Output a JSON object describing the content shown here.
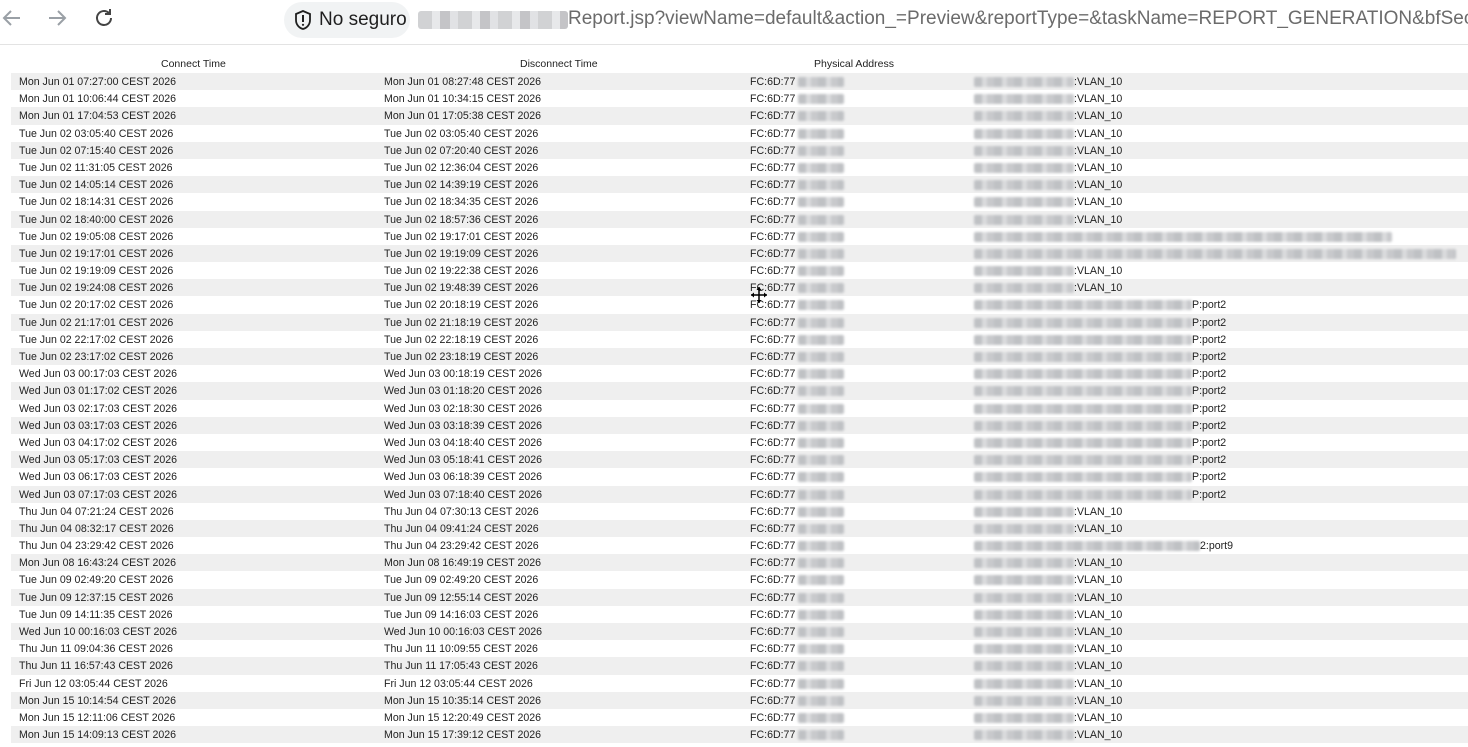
{
  "browser": {
    "security_label": "No seguro",
    "url_path": "Report.jsp?viewName=default&action_=Preview&reportType=&taskName=REPORT_GENERATION&bfSecKey=nx"
  },
  "columns": [
    "Connect Time",
    "Disconnect Time",
    "Physical Address"
  ],
  "rows": [
    {
      "connect": "Mon Jun 01 07:27:00 CEST 2026",
      "disconnect": "Mon Jun 01 08:27:48 CEST 2026",
      "mac": "FC:6D:77",
      "suffix": ":VLAN_10"
    },
    {
      "connect": "Mon Jun 01 10:06:44 CEST 2026",
      "disconnect": "Mon Jun 01 10:34:15 CEST 2026",
      "mac": "FC:6D:77",
      "suffix": ":VLAN_10"
    },
    {
      "connect": "Mon Jun 01 17:04:53 CEST 2026",
      "disconnect": "Mon Jun 01 17:05:38 CEST 2026",
      "mac": "FC:6D:77",
      "suffix": ":VLAN_10"
    },
    {
      "connect": "Tue Jun 02 03:05:40 CEST 2026",
      "disconnect": "Tue Jun 02 03:05:40 CEST 2026",
      "mac": "FC:6D:77",
      "suffix": ":VLAN_10"
    },
    {
      "connect": "Tue Jun 02 07:15:40 CEST 2026",
      "disconnect": "Tue Jun 02 07:20:40 CEST 2026",
      "mac": "FC:6D:77",
      "suffix": ":VLAN_10"
    },
    {
      "connect": "Tue Jun 02 11:31:05 CEST 2026",
      "disconnect": "Tue Jun 02 12:36:04 CEST 2026",
      "mac": "FC:6D:77",
      "suffix": ":VLAN_10"
    },
    {
      "connect": "Tue Jun 02 14:05:14 CEST 2026",
      "disconnect": "Tue Jun 02 14:39:19 CEST 2026",
      "mac": "FC:6D:77",
      "suffix": ":VLAN_10"
    },
    {
      "connect": "Tue Jun 02 18:14:31 CEST 2026",
      "disconnect": "Tue Jun 02 18:34:35 CEST 2026",
      "mac": "FC:6D:77",
      "suffix": ":VLAN_10"
    },
    {
      "connect": "Tue Jun 02 18:40:00 CEST 2026",
      "disconnect": "Tue Jun 02 18:57:36 CEST 2026",
      "mac": "FC:6D:77",
      "suffix": ":VLAN_10"
    },
    {
      "connect": "Tue Jun 02 19:05:08 CEST 2026",
      "disconnect": "Tue Jun 02 19:17:01 CEST 2026",
      "mac": "FC:6D:77",
      "suffix": ""
    },
    {
      "connect": "Tue Jun 02 19:17:01 CEST 2026",
      "disconnect": "Tue Jun 02 19:19:09 CEST 2026",
      "mac": "FC:6D:77",
      "suffix": ""
    },
    {
      "connect": "Tue Jun 02 19:19:09 CEST 2026",
      "disconnect": "Tue Jun 02 19:22:38 CEST 2026",
      "mac": "FC:6D:77",
      "suffix": ":VLAN_10"
    },
    {
      "connect": "Tue Jun 02 19:24:08 CEST 2026",
      "disconnect": "Tue Jun 02 19:48:39 CEST 2026",
      "mac": "FC:6D:77",
      "suffix": ":VLAN_10"
    },
    {
      "connect": "Tue Jun 02 20:17:02 CEST 2026",
      "disconnect": "Tue Jun 02 20:18:19 CEST 2026",
      "mac": "FC:6D:77",
      "suffix": "P:port2"
    },
    {
      "connect": "Tue Jun 02 21:17:01 CEST 2026",
      "disconnect": "Tue Jun 02 21:18:19 CEST 2026",
      "mac": "FC:6D:77",
      "suffix": "P:port2"
    },
    {
      "connect": "Tue Jun 02 22:17:02 CEST 2026",
      "disconnect": "Tue Jun 02 22:18:19 CEST 2026",
      "mac": "FC:6D:77",
      "suffix": "P:port2"
    },
    {
      "connect": "Tue Jun 02 23:17:02 CEST 2026",
      "disconnect": "Tue Jun 02 23:18:19 CEST 2026",
      "mac": "FC:6D:77",
      "suffix": "P:port2"
    },
    {
      "connect": "Wed Jun 03 00:17:03 CEST 2026",
      "disconnect": "Wed Jun 03 00:18:19 CEST 2026",
      "mac": "FC:6D:77",
      "suffix": "P:port2"
    },
    {
      "connect": "Wed Jun 03 01:17:02 CEST 2026",
      "disconnect": "Wed Jun 03 01:18:20 CEST 2026",
      "mac": "FC:6D:77",
      "suffix": "P:port2"
    },
    {
      "connect": "Wed Jun 03 02:17:03 CEST 2026",
      "disconnect": "Wed Jun 03 02:18:30 CEST 2026",
      "mac": "FC:6D:77",
      "suffix": "P:port2"
    },
    {
      "connect": "Wed Jun 03 03:17:03 CEST 2026",
      "disconnect": "Wed Jun 03 03:18:39 CEST 2026",
      "mac": "FC:6D:77",
      "suffix": "P:port2"
    },
    {
      "connect": "Wed Jun 03 04:17:02 CEST 2026",
      "disconnect": "Wed Jun 03 04:18:40 CEST 2026",
      "mac": "FC:6D:77",
      "suffix": "P:port2"
    },
    {
      "connect": "Wed Jun 03 05:17:03 CEST 2026",
      "disconnect": "Wed Jun 03 05:18:41 CEST 2026",
      "mac": "FC:6D:77",
      "suffix": "P:port2"
    },
    {
      "connect": "Wed Jun 03 06:17:03 CEST 2026",
      "disconnect": "Wed Jun 03 06:18:39 CEST 2026",
      "mac": "FC:6D:77",
      "suffix": "P:port2"
    },
    {
      "connect": "Wed Jun 03 07:17:03 CEST 2026",
      "disconnect": "Wed Jun 03 07:18:40 CEST 2026",
      "mac": "FC:6D:77",
      "suffix": "P:port2"
    },
    {
      "connect": "Thu Jun 04 07:21:24 CEST 2026",
      "disconnect": "Thu Jun 04 07:30:13 CEST 2026",
      "mac": "FC:6D:77",
      "suffix": ":VLAN_10"
    },
    {
      "connect": "Thu Jun 04 08:32:17 CEST 2026",
      "disconnect": "Thu Jun 04 09:41:24 CEST 2026",
      "mac": "FC:6D:77",
      "suffix": ":VLAN_10"
    },
    {
      "connect": "Thu Jun 04 23:29:42 CEST 2026",
      "disconnect": "Thu Jun 04 23:29:42 CEST 2026",
      "mac": "FC:6D:77",
      "suffix": "2:port9"
    },
    {
      "connect": "Mon Jun 08 16:43:24 CEST 2026",
      "disconnect": "Mon Jun 08 16:49:19 CEST 2026",
      "mac": "FC:6D:77",
      "suffix": ":VLAN_10"
    },
    {
      "connect": "Tue Jun 09 02:49:20 CEST 2026",
      "disconnect": "Tue Jun 09 02:49:20 CEST 2026",
      "mac": "FC:6D:77",
      "suffix": ":VLAN_10"
    },
    {
      "connect": "Tue Jun 09 12:37:15 CEST 2026",
      "disconnect": "Tue Jun 09 12:55:14 CEST 2026",
      "mac": "FC:6D:77",
      "suffix": ":VLAN_10"
    },
    {
      "connect": "Tue Jun 09 14:11:35 CEST 2026",
      "disconnect": "Tue Jun 09 14:16:03 CEST 2026",
      "mac": "FC:6D:77",
      "suffix": ":VLAN_10"
    },
    {
      "connect": "Wed Jun 10 00:16:03 CEST 2026",
      "disconnect": "Wed Jun 10 00:16:03 CEST 2026",
      "mac": "FC:6D:77",
      "suffix": ":VLAN_10"
    },
    {
      "connect": "Thu Jun 11 09:04:36 CEST 2026",
      "disconnect": "Thu Jun 11 10:09:55 CEST 2026",
      "mac": "FC:6D:77",
      "suffix": ":VLAN_10"
    },
    {
      "connect": "Thu Jun 11 16:57:43 CEST 2026",
      "disconnect": "Thu Jun 11 17:05:43 CEST 2026",
      "mac": "FC:6D:77",
      "suffix": ":VLAN_10"
    },
    {
      "connect": "Fri Jun 12 03:05:44 CEST 2026",
      "disconnect": "Fri Jun 12 03:05:44 CEST 2026",
      "mac": "FC:6D:77",
      "suffix": ":VLAN_10"
    },
    {
      "connect": "Mon Jun 15 10:14:54 CEST 2026",
      "disconnect": "Mon Jun 15 10:35:14 CEST 2026",
      "mac": "FC:6D:77",
      "suffix": ":VLAN_10"
    },
    {
      "connect": "Mon Jun 15 12:11:06 CEST 2026",
      "disconnect": "Mon Jun 15 12:20:49 CEST 2026",
      "mac": "FC:6D:77",
      "suffix": ":VLAN_10"
    },
    {
      "connect": "Mon Jun 15 14:09:13 CEST 2026",
      "disconnect": "Mon Jun 15 17:39:12 CEST 2026",
      "mac": "FC:6D:77",
      "suffix": ":VLAN_10"
    }
  ]
}
